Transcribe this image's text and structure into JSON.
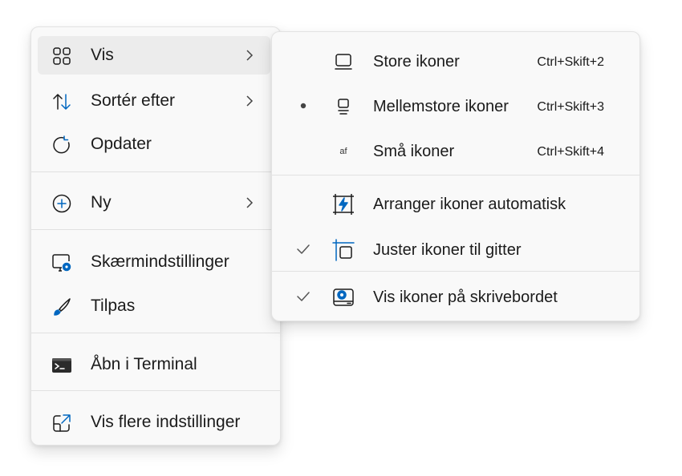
{
  "main_menu": {
    "items": [
      {
        "label": "Vis",
        "icon": "grid-icon",
        "has_submenu": true
      },
      {
        "label": "Sortér efter",
        "icon": "sort-icon",
        "has_submenu": true
      },
      {
        "label": "Opdater",
        "icon": "refresh-icon",
        "has_submenu": false
      },
      {
        "label": "Ny",
        "icon": "add-circle-icon",
        "has_submenu": true
      },
      {
        "label": "Skærmindstillinger",
        "icon": "display-settings-icon",
        "has_submenu": false
      },
      {
        "label": "Tilpas",
        "icon": "brush-icon",
        "has_submenu": false
      },
      {
        "label": "Åbn i Terminal",
        "icon": "terminal-icon",
        "has_submenu": false
      },
      {
        "label": "Vis flere indstillinger",
        "icon": "open-external-icon",
        "has_submenu": false
      }
    ]
  },
  "sub_menu": {
    "items": [
      {
        "label": "Store ikoner",
        "shortcut": "Ctrl+Skift+2",
        "icon": "large-icons-icon",
        "mark": "none"
      },
      {
        "label": "Mellemstore ikoner",
        "shortcut": "Ctrl+Skift+3",
        "icon": "medium-icons-icon",
        "mark": "bullet"
      },
      {
        "label": "Små ikoner",
        "shortcut": "Ctrl+Skift+4",
        "icon": "small-icons-icon",
        "icon_text": "af",
        "mark": "none"
      },
      {
        "label": "Arranger ikoner automatisk",
        "icon": "auto-arrange-icon",
        "mark": "none"
      },
      {
        "label": "Juster ikoner til gitter",
        "icon": "align-grid-icon",
        "mark": "check"
      },
      {
        "label": "Vis ikoner på skrivebordet",
        "icon": "show-desktop-icons-icon",
        "mark": "check"
      }
    ]
  },
  "colors": {
    "accent": "#0067c0",
    "icon_stroke": "#1b1b1b",
    "menu_bg": "#f9f9f9",
    "hover_bg": "#ececec",
    "separator": "#e1e1e1"
  }
}
